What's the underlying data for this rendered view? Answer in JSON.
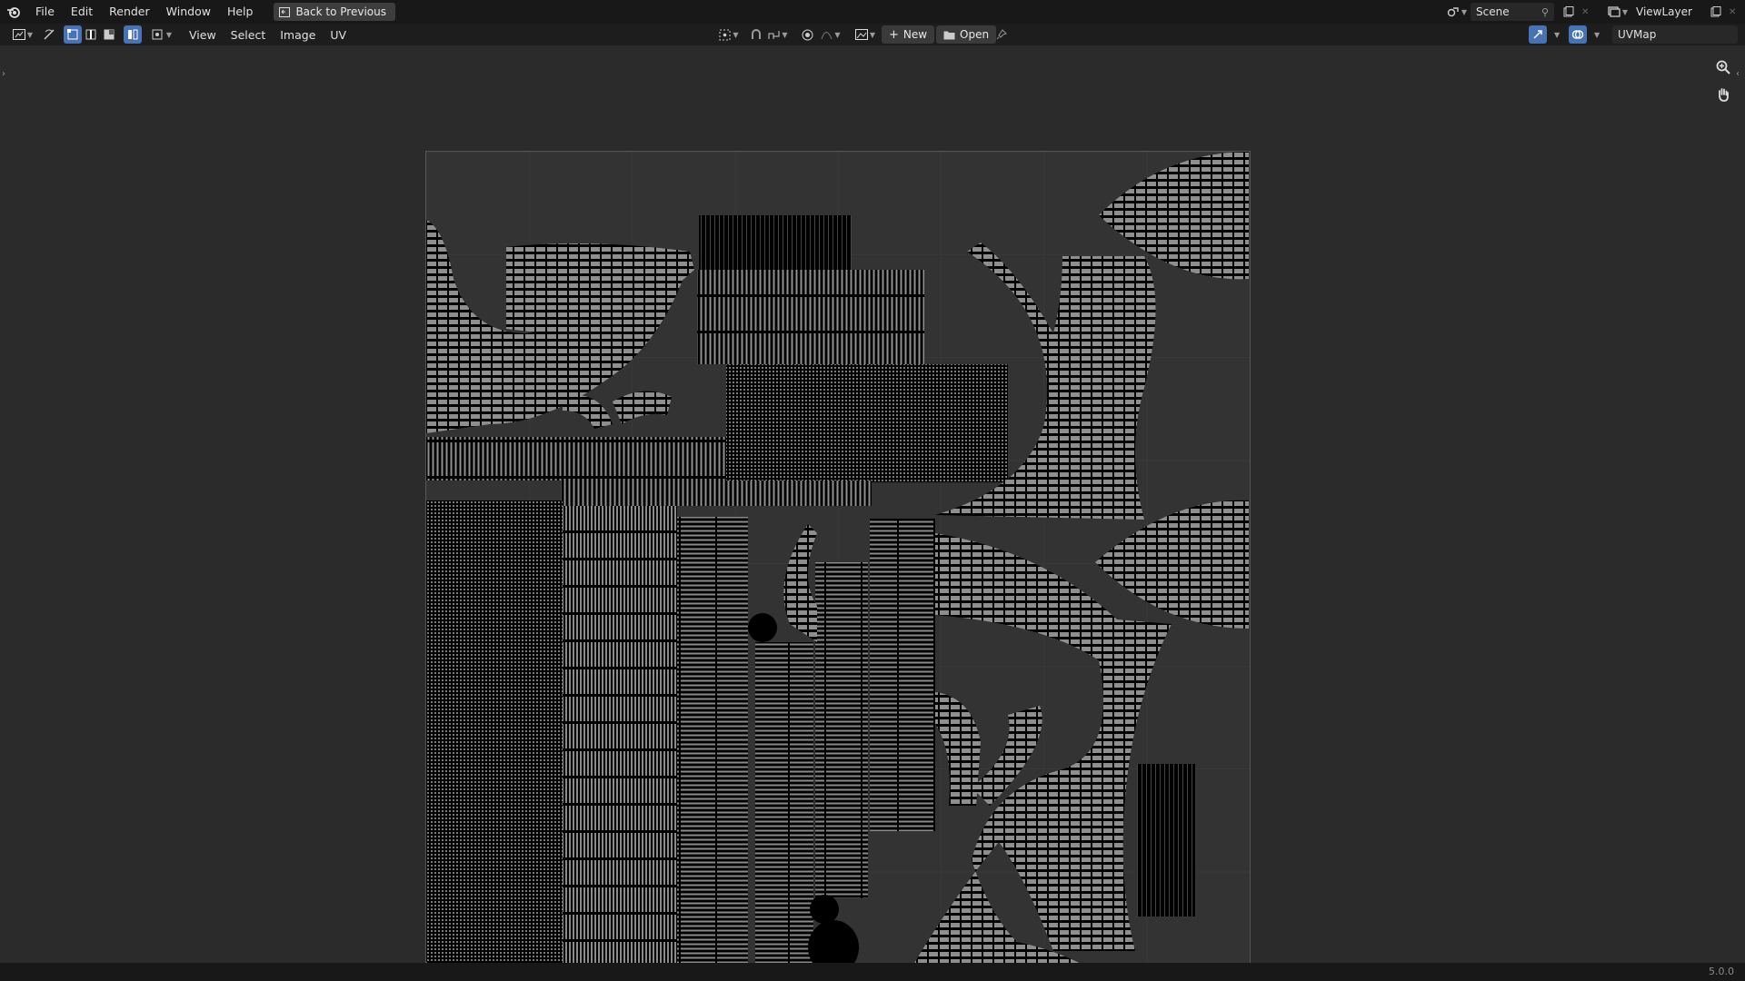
{
  "topbar": {
    "menus": [
      "File",
      "Edit",
      "Render",
      "Window",
      "Help"
    ],
    "back_label": "Back to Previous",
    "scene_value": "Scene",
    "viewlayer_value": "ViewLayer"
  },
  "editor_header": {
    "menus": [
      "View",
      "Select",
      "Image",
      "UV"
    ],
    "new_label": "New",
    "open_label": "Open",
    "uvmap_value": "UVMap"
  },
  "status": {
    "version": "5.0.0"
  },
  "colors": {
    "accent": "#4772b3",
    "background": "#2b2b2b",
    "uv_fill": "#333333",
    "wire": "#000000"
  }
}
